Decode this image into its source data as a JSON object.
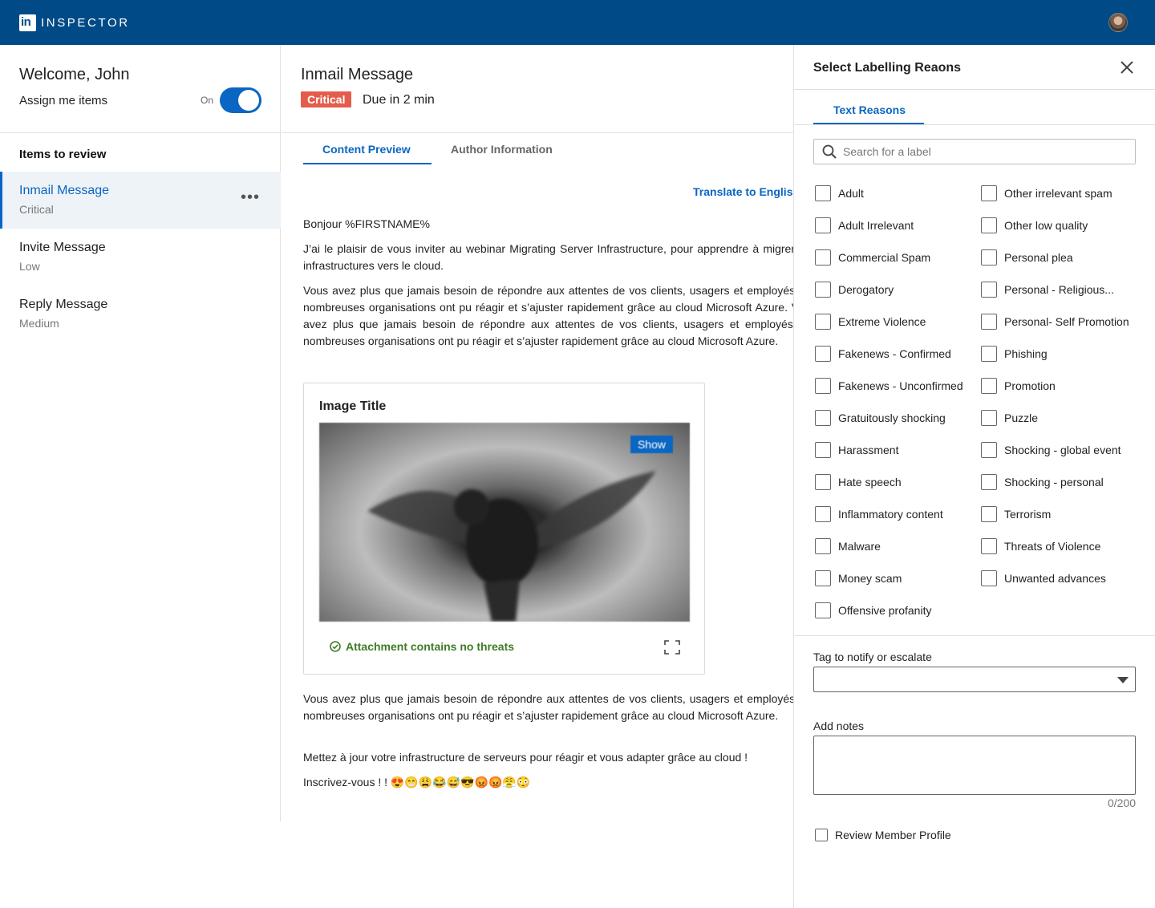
{
  "app": {
    "logo_text": "in",
    "brand": "INSPECTOR"
  },
  "left": {
    "welcome": "Welcome, John",
    "assign_label": "Assign me items",
    "toggle_label": "On",
    "toggle_state": "on",
    "items_heading": "Items to review",
    "items": [
      {
        "title": "Inmail Message",
        "priority": "Critical",
        "active": true
      },
      {
        "title": "Invite Message",
        "priority": "Low",
        "active": false
      },
      {
        "title": "Reply Message",
        "priority": "Medium",
        "active": false
      }
    ],
    "more_icon": "ellipsis-icon"
  },
  "main": {
    "title": "Inmail Message",
    "badge": "Critical",
    "due": "Due in 2 min",
    "tabs": [
      {
        "label": "Content Preview",
        "active": true
      },
      {
        "label": "Author Information",
        "active": false
      }
    ],
    "translate": "Translate to English",
    "greeting": "Bonjour %FIRSTNAME%",
    "para1": "J’ai le plaisir de vous inviter au webinar Migrating Server Infrastructure, pour apprendre à migrer vos infrastructures vers le cloud.",
    "para2": "Vous avez plus que jamais besoin de répondre aux attentes de vos clients, usagers et employés. De nombreuses organisations ont pu réagir et s’ajuster rapidement grâce au cloud Microsoft Azure. Vous avez plus que jamais besoin de répondre aux attentes de vos clients, usagers et employés. De nombreuses organisations ont pu réagir et s’ajuster rapidement grâce au cloud Microsoft Azure.",
    "image_card": {
      "title": "Image Title",
      "show_label": "Show",
      "threat_text": "Attachment contains no threats"
    },
    "para3": "Vous avez plus que jamais besoin de répondre aux attentes de vos clients, usagers et employés. De nombreuses organisations ont pu réagir et s’ajuster rapidement grâce au cloud Microsoft Azure.",
    "para4": "Mettez à jour votre infrastructure de serveurs pour réagir et vous adapter grâce au cloud !",
    "para5": "Inscrivez-vous ! ! 😍😁😩😂😅😎😡😡😤😳"
  },
  "panel": {
    "title": "Select Labelling Reaons",
    "tab": "Text Reasons",
    "search_placeholder": "Search for a label",
    "reasons_left": [
      "Adult",
      "Adult Irrelevant",
      "Commercial Spam",
      "Derogatory",
      "Extreme Violence",
      "Fakenews - Confirmed",
      "Fakenews - Unconfirmed",
      "Gratuitously shocking",
      "Harassment",
      "Hate speech",
      "Inflammatory content",
      "Malware",
      "Money scam",
      "Offensive profanity"
    ],
    "reasons_right": [
      "Other irrelevant spam",
      "Other low quality",
      "Personal plea",
      "Personal - Religious...",
      "Personal- Self Promotion",
      "Phishing",
      "Promotion",
      "Puzzle",
      "Shocking - global event",
      "Shocking - personal",
      "Terrorism",
      "Threats of Violence",
      "Unwanted advances"
    ],
    "tag_label": "Tag to notify or escalate",
    "tag_value": "",
    "notes_label": "Add notes",
    "notes_value": "",
    "notes_counter": "0/200",
    "review_label": "Review Member Profile"
  },
  "colors": {
    "topbar": "#004b87",
    "accent": "#0a66c2",
    "critical": "#e45d4c",
    "success": "#3e7b27"
  }
}
